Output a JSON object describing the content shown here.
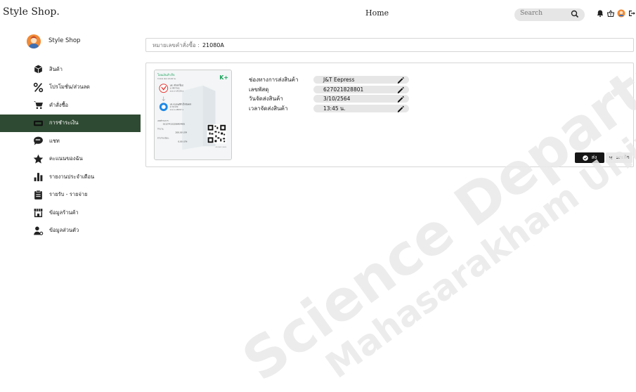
{
  "app": {
    "brand": "Style Shop.",
    "page_title": "Home"
  },
  "search": {
    "placeholder": "Search"
  },
  "sidebar": {
    "shop_name": "Style Shop",
    "items": [
      {
        "label": "สินค้า",
        "icon": "box-icon"
      },
      {
        "label": "โปรโมชั่น/ส่วนลด",
        "icon": "percent-icon"
      },
      {
        "label": "คำสั่งซื้อ",
        "icon": "cart-icon"
      },
      {
        "label": "การชำระเงิน",
        "icon": "payment-icon",
        "active": true
      },
      {
        "label": "แชท",
        "icon": "chat-icon"
      },
      {
        "label": "คะแนนของฉัน",
        "icon": "star-icon"
      },
      {
        "label": "รายงานประจำเดือน",
        "icon": "bar-chart-icon"
      },
      {
        "label": "รายรับ - รายจ่าย",
        "icon": "clipboard-icon"
      },
      {
        "label": "ข้อมูลร้านค้า",
        "icon": "store-icon"
      },
      {
        "label": "ข้อมูลส่วนตัว",
        "icon": "user-icon"
      }
    ]
  },
  "order": {
    "number_label": "หมายเลขคำสั่งซื้อ :",
    "number_value": "21080A"
  },
  "details": {
    "fields": [
      {
        "label": "ช่องทางการส่งสินค้า",
        "value": "J&T Eepress"
      },
      {
        "label": "เลขพัสดุ",
        "value": "627021828801"
      },
      {
        "label": "วันจัดส่งสินค้า",
        "value": "3/10/2564"
      },
      {
        "label": "เวลาจัดส่งสินค้า",
        "value": "13:45 น."
      }
    ]
  },
  "slip": {
    "header": "โอนเงินสำเร็จ",
    "date": "3 ต.ค. 64 13:20 น.",
    "brand": "K+",
    "sender": "นส. สไตล์ ช็อป",
    "sender_bank": "ธ.กสิกรไทย",
    "sender_acc": "xxx-x-x4326-x",
    "receiver": "บจ.เจแอนด์ที เอ็กซ์เพรส",
    "receiver_bank": "ธ.กรุงไทย",
    "receiver_acc": "xxx-x-x8097-x",
    "ref_label": "เลขที่รายการ:",
    "ref_value": "011274131206404405",
    "amount_label": "จำนวน:",
    "amount_value": "200.00 บาท",
    "fee_label": "ค่าธรรมเนียม:",
    "fee_value": "0.00 บาท",
    "scan_note": "สแกนตรวจสอบ"
  },
  "actions": {
    "send_label": "ส่ง",
    "cancel_label": "ยกเลิก"
  },
  "watermark": {
    "line1": "Science Department",
    "line2": "Mahasarakham University"
  },
  "colors": {
    "active_bg": "#2f4a32",
    "primary_btn": "#161616",
    "pill_bg": "#e6e6e6",
    "kplus": "#1aa35b"
  }
}
